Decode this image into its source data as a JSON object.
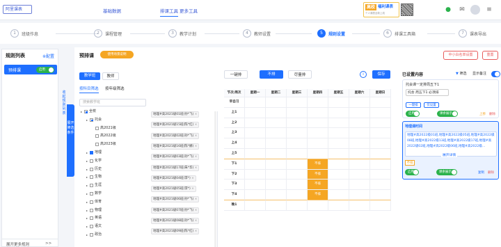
{
  "topbar": {
    "logo": "阿里课表",
    "nav": [
      "基础数据",
      "排课工具",
      "更多工具"
    ],
    "banner": {
      "tag": "高校",
      "title": "福利课表",
      "sub": "个人课表全新上线"
    }
  },
  "steps": [
    {
      "num": "1",
      "label": "班级作息"
    },
    {
      "num": "2",
      "label": "课程管理"
    },
    {
      "num": "3",
      "label": "教学计划"
    },
    {
      "num": "4",
      "label": "教师设置"
    },
    {
      "num": "5",
      "label": "规则设置"
    },
    {
      "num": "6",
      "label": "排课工具箱"
    },
    {
      "num": "7",
      "label": "课表导出"
    }
  ],
  "left": {
    "title": "规则列表",
    "link": "※配置",
    "item": "预排课",
    "toggle": "启用",
    "bottom": "展开更多规则",
    "bottom_arrow": ">>"
  },
  "collapse": "收起规则列表",
  "bluetab": "展开筛选条件",
  "main": {
    "title": "预排课",
    "orange": "使用场景说明",
    "btn_a": "中小白名单设置",
    "btn_b": "重置",
    "seg": [
      "教学班",
      "教师"
    ],
    "tabs": [
      "按科目筛选",
      "按年级筛选"
    ],
    "search_placeholder": "搜索教学班",
    "tree": [
      {
        "label": "全校",
        "indent": 0,
        "cb": "part"
      },
      {
        "label": "托会",
        "indent": 1,
        "cb": "part"
      },
      {
        "label": "高2021级",
        "indent": 2,
        "cb": "off"
      },
      {
        "label": "高2022级",
        "indent": 2,
        "cb": "off"
      },
      {
        "label": "高2023级",
        "indent": 2,
        "cb": "off"
      },
      {
        "label": "地理",
        "indent": 1,
        "cb": "on"
      },
      {
        "label": "化学",
        "indent": 1,
        "cb": "off"
      },
      {
        "label": "历史",
        "indent": 1,
        "cb": "off"
      },
      {
        "label": "生物",
        "indent": 1,
        "cb": "off"
      },
      {
        "label": "生涯",
        "indent": 1,
        "cb": "off"
      },
      {
        "label": "数学",
        "indent": 1,
        "cb": "off"
      },
      {
        "label": "体育",
        "indent": 1,
        "cb": "off"
      },
      {
        "label": "物理",
        "indent": 1,
        "cb": "off"
      },
      {
        "label": "英语",
        "indent": 1,
        "cb": "off"
      },
      {
        "label": "语文",
        "indent": 1,
        "cb": "off"
      },
      {
        "label": "政治",
        "indent": 1,
        "cb": "off"
      }
    ],
    "chips": [
      "地理#高2021级01班(孙*飞)",
      "地理#高2021级15班(陈*红)",
      "地理#高2021级02班(孙*飞)",
      "地理#高2021级16班(陈*娜)",
      "地理#高2021级03班(孙*飞)",
      "地理#高2021级17班(朱*华)",
      "地理#高2021级04班(李*)",
      "地理#高2021级05班(李*)",
      "地理#高2021级06班(孙*飞)",
      "地理#高2021级07班(孙*飞)",
      "地理#高2021级08班(孙*飞)",
      "地理#高2021级09班(陈*红)"
    ],
    "chip_x": "×",
    "grid_buttons": [
      "一键排",
      "不排",
      "尽量排"
    ],
    "save": "保存",
    "info_icon": "i",
    "cols": [
      "节次/周次",
      "星期一",
      "星期二",
      "星期三",
      "星期四",
      "星期五",
      "星期六",
      "星期日"
    ],
    "rows": [
      "早自习",
      "上1",
      "上2",
      "上3",
      "上4",
      "上5",
      "下1",
      "下2",
      "下3",
      "下4",
      "晚1"
    ],
    "selected_text": "不排"
  },
  "right": {
    "title": "已设置内容",
    "filter": "筛选",
    "show_note": "显示备注",
    "card1": {
      "title": "托会课一定排周五下1",
      "tag": "托会 周五下1 必须排",
      "btn1": "一键排",
      "btn2": "仅设置",
      "ops": [
        "上移",
        "删除"
      ]
    },
    "card2": {
      "title": "地理课时间",
      "body": "地理#高2022级01班,地理#高2022级05班,地理#高2022级08班,地理#高2022级13班,地理#高2022级17班,地理#高2022级02班,地理#高2022级06班,地理#高2022级...",
      "more": "展开详情",
      "tag": "不排",
      "ops": [
        "复制",
        "删除"
      ]
    },
    "toggle_on": "启用",
    "toggle_note": "课余展示"
  },
  "colors": {
    "primary": "#1e6fff",
    "orange": "#f5a623",
    "green": "#2bb24c"
  }
}
